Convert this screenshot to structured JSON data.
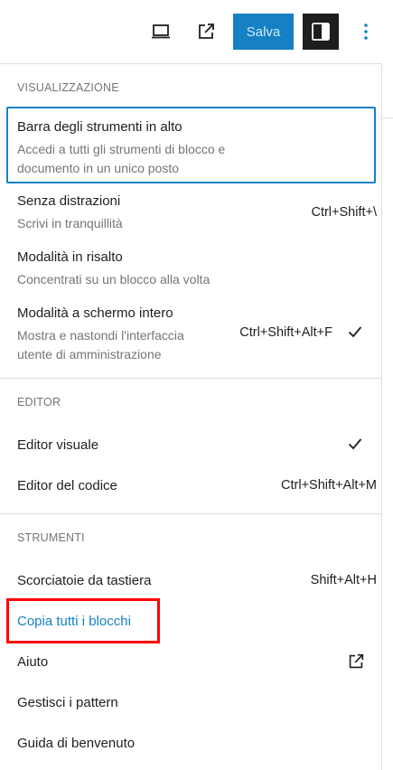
{
  "toolbar": {
    "save_label": "Salva",
    "icons": [
      "desktop-preview-icon",
      "external-view-icon",
      "sidebar-settings-icon",
      "more-vertical-icon"
    ]
  },
  "sections": {
    "view": {
      "title": "VISUALIZZAZIONE",
      "items": [
        {
          "label": "Barra degli strumenti in alto",
          "desc_line1": "Accedi a tutti gli strumenti di blocco e",
          "desc_line2": "documento in un unico posto"
        },
        {
          "label": "Senza distrazioni",
          "desc_line1": "Scrivi in tranquillità",
          "shortcut": "Ctrl+Shift+\\"
        },
        {
          "label": "Modalità in risalto",
          "desc_line1": "Concentrati su un blocco alla volta"
        },
        {
          "label": "Modalità a schermo intero",
          "desc_line1": "Mostra e nastondi l'interfaccia",
          "desc_line2": "utente di amministrazione",
          "shortcut": "Ctrl+Shift+Alt+F",
          "checked": true
        }
      ]
    },
    "editor": {
      "title": "EDITOR",
      "items": [
        {
          "label": "Editor visuale",
          "checked": true
        },
        {
          "label": "Editor del codice",
          "shortcut": "Ctrl+Shift+Alt+M"
        }
      ]
    },
    "tools": {
      "title": "STRUMENTI",
      "items": [
        {
          "label": "Scorciatoie da tastiera",
          "shortcut": "Shift+Alt+H"
        },
        {
          "label": "Copia tutti i blocchi"
        },
        {
          "label": "Aiuto"
        },
        {
          "label": "Gestisci i pattern"
        },
        {
          "label": "Guida di benvenuto"
        }
      ]
    }
  },
  "colors": {
    "accent": "#1581c4",
    "highlight": "#ff0000",
    "text": "#1e1e1e",
    "muted": "#757575"
  }
}
